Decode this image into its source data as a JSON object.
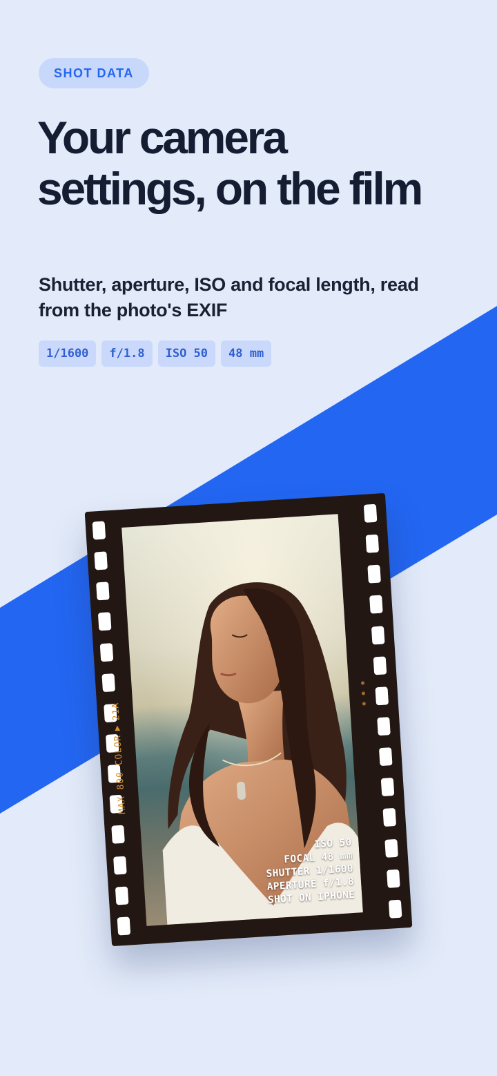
{
  "badge": "SHOT DATA",
  "title": "Your camera settings, on the film",
  "subtitle": "Shutter, aperture, ISO and focal length, read from the photo's EXIF",
  "chips": [
    "1/1600",
    "f/1.8",
    "ISO 50",
    "48 mm"
  ],
  "film": {
    "edge_label": "MAX 800 COLOR",
    "edge_frame": "21A",
    "exif_lines": [
      "ISO 50",
      "FOCAL 48 mm",
      "SHUTTER 1/1600",
      "APERTURE f/1.8",
      "SHOT ON IPHONE"
    ]
  },
  "colors": {
    "background": "#e3ebfa",
    "accent_band": "#2366f1",
    "title": "#151d33",
    "badge_bg": "#c8d8fb",
    "chip_bg": "#cad9fb",
    "film": "#231714",
    "edge_text": "#d4902c"
  }
}
